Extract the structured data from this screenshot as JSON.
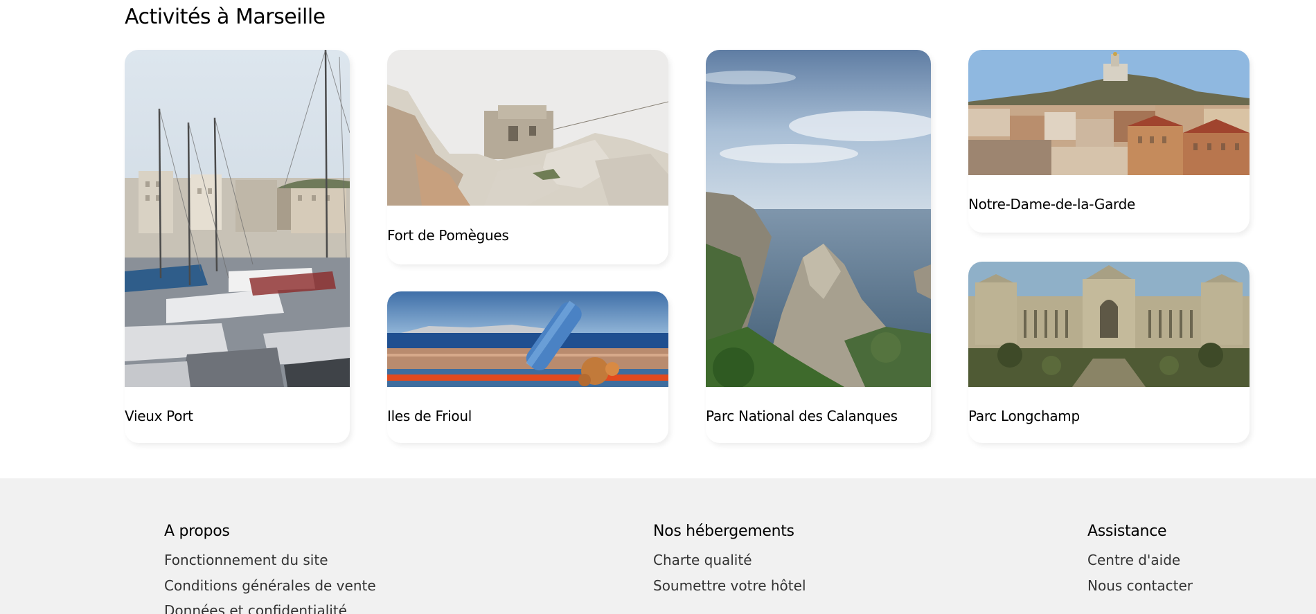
{
  "section": {
    "title": "Activités à Marseille"
  },
  "cards": [
    {
      "label": "Vieux Port",
      "image_alt": "harbor-photo"
    },
    {
      "label": "Fort de Pomègues",
      "image_alt": "fort-photo"
    },
    {
      "label": "Iles de Frioul",
      "image_alt": "islands-photo"
    },
    {
      "label": "Parc National des Calanques",
      "image_alt": "calanques-photo"
    },
    {
      "label": "Notre-Dame-de-la-Garde",
      "image_alt": "basilica-photo"
    },
    {
      "label": "Parc Longchamp",
      "image_alt": "palace-photo"
    }
  ],
  "footer": {
    "about": {
      "title": "A propos",
      "links": [
        "Fonctionnement du site",
        "Conditions générales de vente",
        "Données et confidentialité"
      ]
    },
    "lodging": {
      "title": "Nos hébergements",
      "links": [
        "Charte qualité",
        "Soumettre votre hôtel"
      ]
    },
    "support": {
      "title": "Assistance",
      "links": [
        "Centre d'aide",
        "Nous contacter"
      ]
    }
  },
  "colors": {
    "footer_background": "#f1f1f1",
    "page_background": "#ffffff"
  }
}
